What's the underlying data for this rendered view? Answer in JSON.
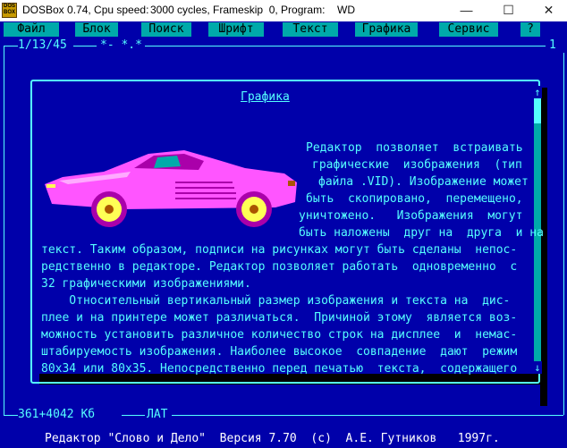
{
  "window": {
    "icon_text": "DOS BOX",
    "title_parts": [
      "DOSBox 0.74, Cpu speed:",
      "3000 cycles, Frameskip  0, Program:",
      "WD"
    ],
    "minimize": "—",
    "maximize": "☐",
    "close": "✕"
  },
  "menu": {
    "items": [
      "Файл",
      "Блок",
      "Поиск",
      "Шрифт",
      "Текст",
      "Графика",
      "Сервис",
      "?"
    ]
  },
  "frame": {
    "position": "1/13/45",
    "marks": "*- *.*",
    "right_marker": "1"
  },
  "doc": {
    "heading": "Графика",
    "wrapped_lines": [
      "Редактор  позволяет  встраивать",
      "графические  изображения  (тип",
      "файла .VID). Изображение может",
      "быть  скопировано,  перемещено,",
      "уничтожено.   Изображения  могут",
      "быть наложены  друг на  друга  и на"
    ],
    "lines": [
      "текст. Таким образом, подписи на рисунках могут быть сделаны  непос-",
      "редственно в редакторе. Редактор позволяет работать  одновременно  с",
      "32 графическими изображениями.",
      "    Относительный вертикальный размер изображения и текста на  дис-",
      "плее и на принтере может различаться.  Причиной этому  является воз-",
      "можность установить различное количество строк на дисплее  и  немас-",
      "штабируемость изображения. Наиболее высокое  совпадение  дают  режим",
      "80x34 или 80x35. Непосредственно перед печатью  текста,  содержащего"
    ],
    "scroll_up": "↑",
    "scroll_down": "↓"
  },
  "statusbar": {
    "size": "361+4042 Кб",
    "layout": "ЛАТ",
    "footer": "Редактор \"Слово и Дело\"  Версия 7.70  (c)  А.Е. Гутников   1997г."
  }
}
